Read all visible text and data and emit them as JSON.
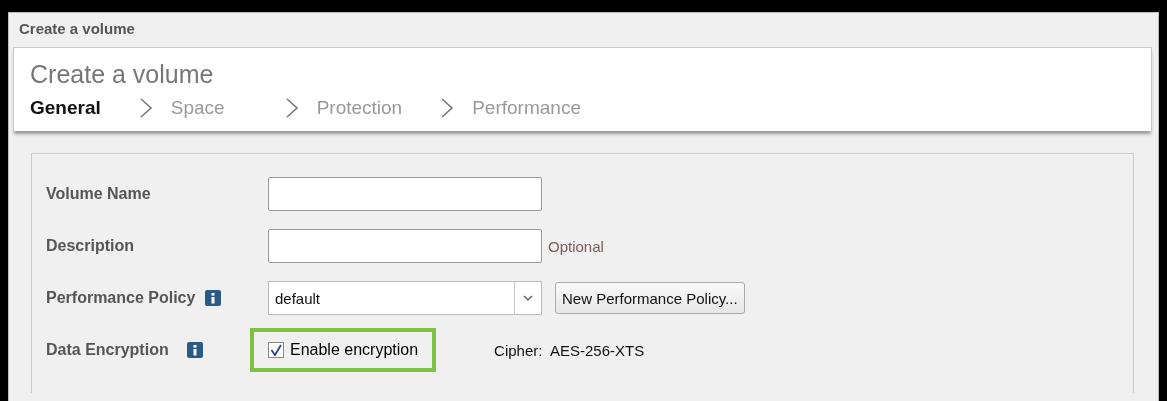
{
  "window": {
    "title": "Create a volume"
  },
  "header": {
    "title": "Create a volume"
  },
  "steps": [
    {
      "label": "General",
      "selected": true
    },
    {
      "label": "Space",
      "selected": false
    },
    {
      "label": "Protection",
      "selected": false
    },
    {
      "label": "Performance",
      "selected": false
    }
  ],
  "form": {
    "rows": [
      {
        "kind": "text",
        "label": "Volume Name",
        "info": false
      },
      {
        "kind": "text",
        "label": "Description",
        "info": false,
        "hint": "Optional"
      },
      {
        "kind": "select",
        "label": "Performance Policy",
        "info": true,
        "value": "default",
        "button": "New Performance Policy..."
      },
      {
        "kind": "checkbox",
        "label": "Data Encryption",
        "info": true,
        "option": "Enable encryption",
        "checked": true,
        "highlighted": true,
        "cipher_label": "Cipher:",
        "cipher": "AES-256-XTS"
      }
    ]
  }
}
